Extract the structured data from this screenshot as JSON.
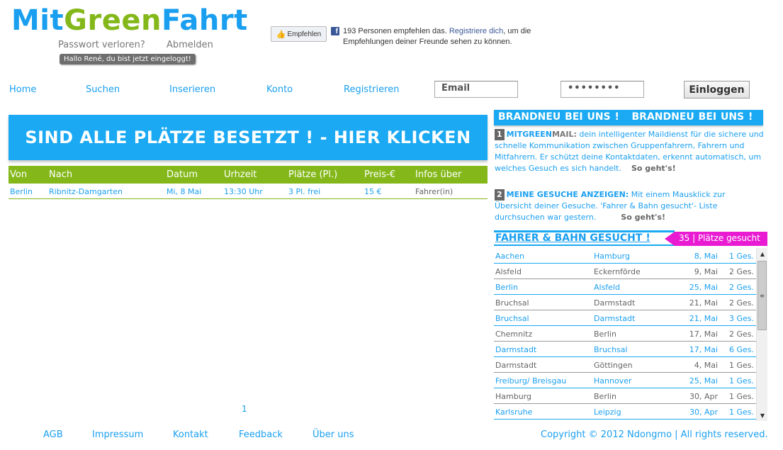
{
  "brand": {
    "logo_part1": "Mit",
    "logo_part2": "Green",
    "logo_part3": "Fahrt",
    "accent_blue": "#1a9ff0",
    "accent_green": "#84b81a",
    "accent_magenta": "#e81bd2"
  },
  "user": {
    "password_lost": "Passwort verloren?",
    "logout": "Abmelden",
    "logged_in_msg": "Hallo René, du bist jetzt eingeloggt!"
  },
  "facebook": {
    "like_label": "Empfehlen",
    "text_before": "193 Personen empfehlen das. ",
    "link": "Registriere dich",
    "text_after": ", um die Empfehlungen deiner Freunde sehen zu können."
  },
  "nav": {
    "home": "Home",
    "search": "Suchen",
    "post": "Inserieren",
    "account": "Konto",
    "register": "Registrieren",
    "email_value": "Email",
    "password_value": "••••••••",
    "login_button": "Einloggen"
  },
  "banner": {
    "text": "SIND ALLE PLÄTZE BESETZT ! - HIER KLICKEN"
  },
  "results": {
    "headers": [
      "Von",
      "Nach",
      "Datum",
      "Urhzeit",
      "Plätze (Pl.)",
      "Preis-€",
      "Infos über"
    ],
    "rows": [
      [
        "Berlin",
        "Ribnitz-Damgarten",
        "Mi, 8 Mai",
        "13:30 Uhr",
        "3 Pl. frei",
        "15 €",
        "Fahrer(in)"
      ]
    ]
  },
  "pager": {
    "current": "1"
  },
  "news": {
    "header": "BRANDNEU BEI UNS !   BRANDNEU BEI UNS !",
    "item1_num": "1",
    "item1_title_a": "MITGREEN",
    "item1_title_b": "MAIL:",
    "item1_text": " dein intelligenter Maildienst für die sichere und schnelle Kommunikation zwischen Gruppenfahrern, Fahrern und Mitfahrern. Er schützt deine Kontaktdaten, erkennt automatisch, um welches Gesuch es sich handelt.",
    "item1_more": "So geht's!",
    "item2_num": "2",
    "item2_title": "MEINE GESUCHE ANZEIGEN:",
    "item2_text": " Mit einem Mausklick zur Übersicht deiner Gesuche. 'Fahrer & Bahn gesucht'- Liste durchsuchen war gestern.",
    "item2_more": "So geht's!"
  },
  "search_panel": {
    "title": "FAHRER & BAHN GESUCHT !",
    "count": "35 | Plätze gesucht",
    "rows": [
      {
        "von": "Aachen",
        "nach": "Hamburg",
        "datum": "8, Mai",
        "ges": "1 Ges.",
        "style": "blue"
      },
      {
        "von": "Alsfeld",
        "nach": "Eckernförde",
        "datum": "9, Mai",
        "ges": "2 Ges.",
        "style": "gray"
      },
      {
        "von": "Berlin",
        "nach": "Alsfeld",
        "datum": "25, Mai",
        "ges": "2 Ges.",
        "style": "blue"
      },
      {
        "von": "Bruchsal",
        "nach": "Darmstadt",
        "datum": "21, Mai",
        "ges": "2 Ges.",
        "style": "gray"
      },
      {
        "von": "Bruchsal",
        "nach": "Darmstadt",
        "datum": "21, Mai",
        "ges": "3 Ges.",
        "style": "blue"
      },
      {
        "von": "Chemnitz",
        "nach": "Berlin",
        "datum": "17, Mai",
        "ges": "2 Ges.",
        "style": "gray"
      },
      {
        "von": "Darmstadt",
        "nach": "Bruchsal",
        "datum": "17, Mai",
        "ges": "6 Ges.",
        "style": "blue"
      },
      {
        "von": "Darmstadt",
        "nach": "Göttingen",
        "datum": "4, Mai",
        "ges": "1 Ges.",
        "style": "gray"
      },
      {
        "von": "Freiburg/ Breisgau",
        "nach": "Hannover",
        "datum": "25, Mai",
        "ges": "1 Ges.",
        "style": "blue"
      },
      {
        "von": "Hamburg",
        "nach": "Berlin",
        "datum": "30, Apr",
        "ges": "1 Ges.",
        "style": "gray"
      },
      {
        "von": "Karlsruhe",
        "nach": "Leipzig",
        "datum": "30, Apr",
        "ges": "1 Ges.",
        "style": "blue"
      }
    ]
  },
  "footer": {
    "agb": "AGB",
    "impressum": "Impressum",
    "contact": "Kontakt",
    "feedback": "Feedback",
    "about": "Über uns",
    "copyright": "Copyright © 2012 Ndongmo | All rights reserved."
  }
}
